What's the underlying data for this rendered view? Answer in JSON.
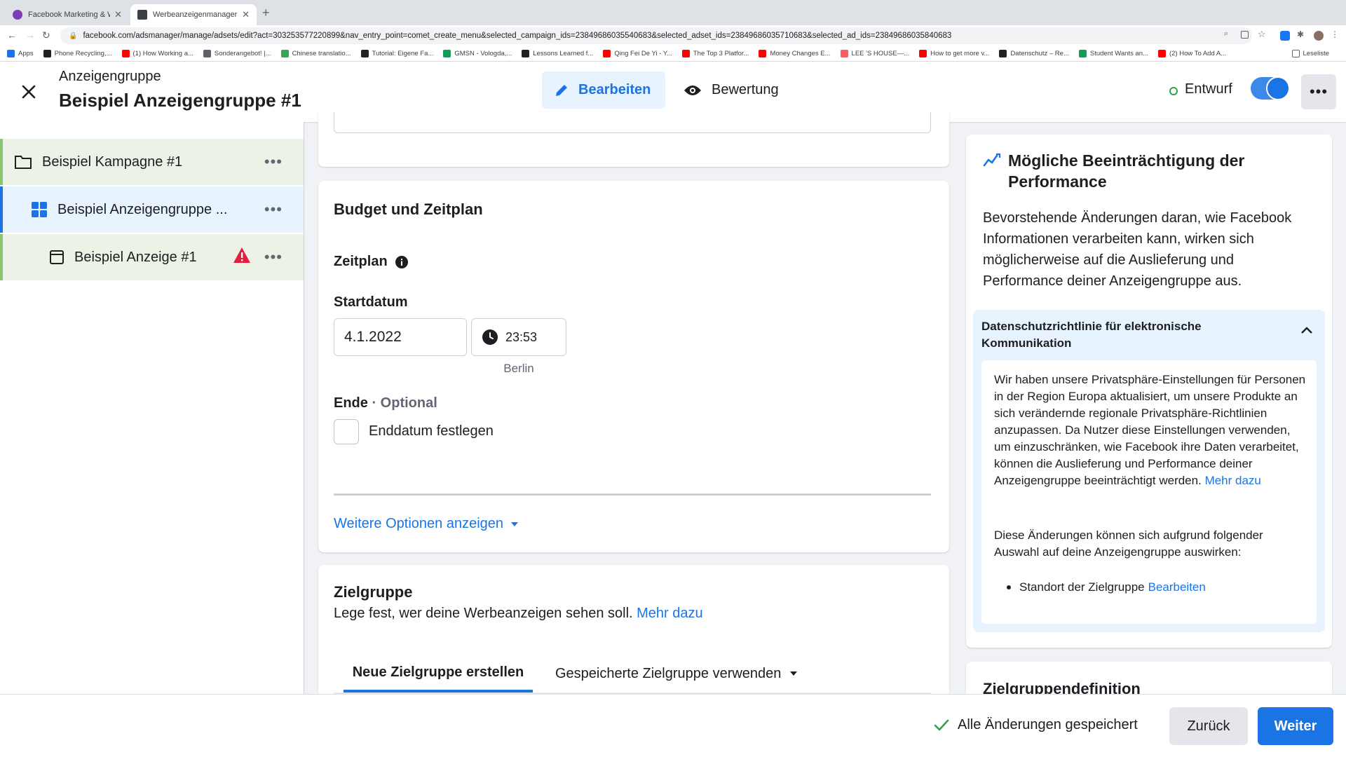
{
  "browser": {
    "tabs": [
      {
        "title": "Facebook Marketing & Werbea...",
        "active": false,
        "favicon_color": "#7b3fb3"
      },
      {
        "title": "Werbeanzeigenmanager - Wer...",
        "active": true,
        "favicon_color": "#3c4043"
      }
    ],
    "url": "facebook.com/adsmanager/manage/adsets/edit?act=303253577220899&nav_entry_point=comet_create_menu&selected_campaign_ids=23849686035540683&selected_adset_ids=23849686035710683&selected_ad_ids=23849686035840683",
    "bookmarks": [
      {
        "label": "Apps",
        "color": "#1a73e8"
      },
      {
        "label": "Phone Recycling,...",
        "color": "#202124"
      },
      {
        "label": "(1) How Working a...",
        "color": "#ff0000"
      },
      {
        "label": "Sonderangebot! |...",
        "color": "#5f6368"
      },
      {
        "label": "Chinese translatio...",
        "color": "#34a853"
      },
      {
        "label": "Tutorial: Eigene Fa...",
        "color": "#202124"
      },
      {
        "label": "GMSN - Vologda,...",
        "color": "#0f9d58"
      },
      {
        "label": "Lessons Learned f...",
        "color": "#202124"
      },
      {
        "label": "Qing Fei De Yi - Y...",
        "color": "#ff0000"
      },
      {
        "label": "The Top 3 Platfor...",
        "color": "#ff0000"
      },
      {
        "label": "Money Changes E...",
        "color": "#ff0000"
      },
      {
        "label": "LEE 'S HOUSE—...",
        "color": "#ff5a5f"
      },
      {
        "label": "How to get more v...",
        "color": "#ff0000"
      },
      {
        "label": "Datenschutz – Re...",
        "color": "#202124"
      },
      {
        "label": "Student Wants an...",
        "color": "#0f9d58"
      },
      {
        "label": "(2) How To Add A...",
        "color": "#ff0000"
      }
    ],
    "reading_list": "Leseliste"
  },
  "header": {
    "subtitle": "Anzeigengruppe",
    "title": "Beispiel Anzeigengruppe #1",
    "edit_tab": "Bearbeiten",
    "review_tab": "Bewertung",
    "status": "Entwurf",
    "more": "•••"
  },
  "tree": {
    "campaign": "Beispiel Kampagne #1",
    "adset": "Beispiel Anzeigengruppe ...",
    "ad": "Beispiel Anzeige #1",
    "dots": "•••"
  },
  "budget": {
    "heading": "Budget und Zeitplan",
    "schedule_label": "Zeitplan",
    "start_label": "Startdatum",
    "start_date": "4.1.2022",
    "start_time": "23:53",
    "timezone": "Berlin",
    "end_label": "Ende",
    "end_optional": "· Optional",
    "end_checkbox": "Enddatum festlegen",
    "more_options": "Weitere Optionen anzeigen"
  },
  "audience": {
    "heading": "Zielgruppe",
    "description": "Lege fest, wer deine Werbeanzeigen sehen soll.",
    "learn_more": "Mehr dazu",
    "tab_new": "Neue Zielgruppe erstellen",
    "tab_saved": "Gespeicherte Zielgruppe verwenden"
  },
  "performance": {
    "heading": "Mögliche Beeinträchtigung der Performance",
    "intro": "Bevorstehende Änderungen daran, wie Facebook Informationen verarbeiten kann, wirken sich möglicherweise auf die Auslieferung und Performance deiner Anzeigengruppe aus.",
    "section_title": "Datenschutzrichtlinie für elektronische Kommunikation",
    "section_body": "Wir haben unsere Privatsphäre-Einstellungen für Personen in der Region Europa aktualisiert, um unsere Produkte an sich verändernde regionale Privatsphäre-Richtlinien anzupassen. Da Nutzer diese Einstellungen verwenden, um einzuschränken, wie Facebook ihre Daten verarbeitet, können die Auslieferung und Performance deiner Anzeigengruppe beeinträchtigt werden.",
    "section_link": "Mehr dazu",
    "section_body2": "Diese Änderungen können sich aufgrund folgender Auswahl auf deine Anzeigengruppe auswirken:",
    "bullet_text": "Standort der Zielgruppe",
    "bullet_link": "Bearbeiten",
    "next_heading": "Zielgruppendefinition"
  },
  "footer": {
    "saved": "Alle Änderungen gespeichert",
    "back": "Zurück",
    "next": "Weiter"
  },
  "colors": {
    "accent": "#1b74e4",
    "campaign_row_bg": "#ecf3e6",
    "adset_row_bg": "#e7f3ff",
    "status_green": "#31a24c",
    "warning_red": "#e41e3f"
  }
}
